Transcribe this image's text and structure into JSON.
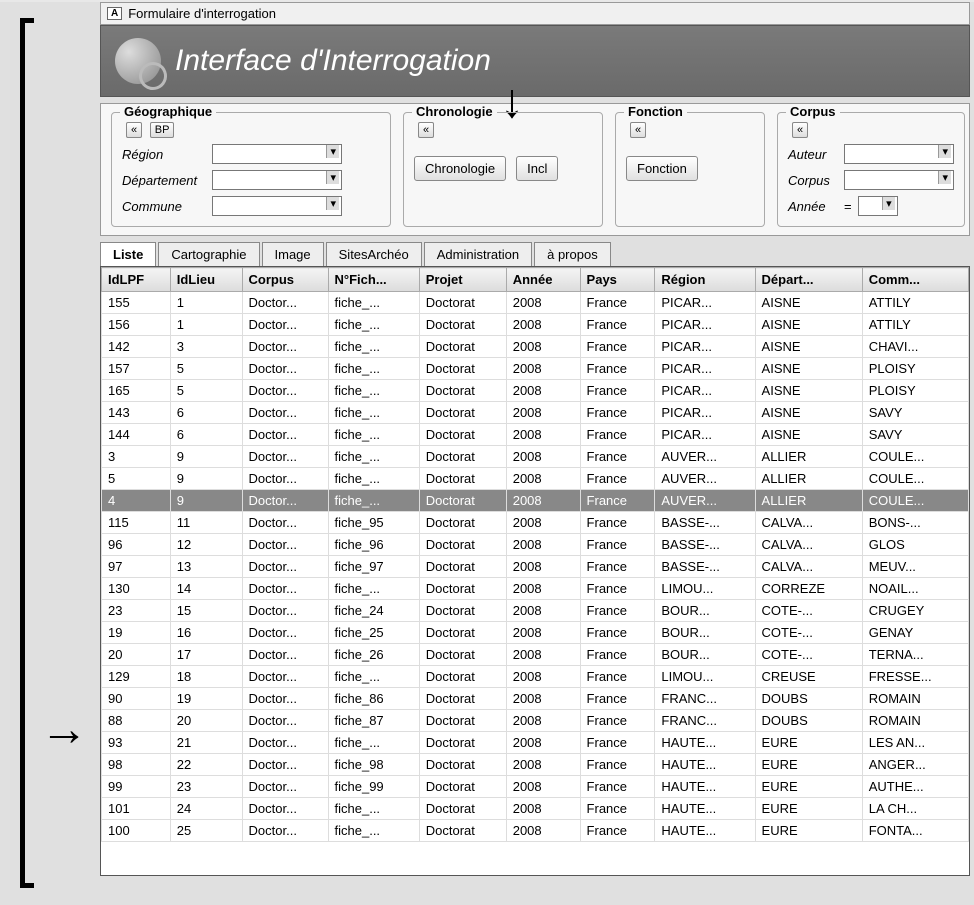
{
  "window_title": "Formulaire d'interrogation",
  "header_title": "Interface d'Interrogation",
  "filters": {
    "geo": {
      "legend": "Géographique",
      "btn_collapse": "«",
      "btn_bp": "BP",
      "region_label": "Région",
      "dept_label": "Département",
      "commune_label": "Commune"
    },
    "chrono": {
      "legend": "Chronologie",
      "btn_collapse": "«",
      "btn_chrono": "Chronologie",
      "btn_incl": "Incl"
    },
    "fonction": {
      "legend": "Fonction",
      "btn_collapse": "«",
      "btn_fonction": "Fonction"
    },
    "corpus": {
      "legend": "Corpus",
      "btn_collapse": "«",
      "auteur_label": "Auteur",
      "corpus_label": "Corpus",
      "annee_label": "Année",
      "annee_op": "="
    }
  },
  "tabs": [
    "Liste",
    "Cartographie",
    "Image",
    "SitesArchéo",
    "Administration",
    "à propos"
  ],
  "columns": [
    "IdLPF",
    "IdLieu",
    "Corpus",
    "N°Fich...",
    "Projet",
    "Année",
    "Pays",
    "Région",
    "Départ...",
    "Comm..."
  ],
  "rows": [
    {
      "idlpf": "155",
      "idlieu": "1",
      "corpus": "Doctor...",
      "fiche": "fiche_...",
      "projet": "Doctorat",
      "annee": "2008",
      "pays": "France",
      "region": "PICAR...",
      "dept": "AISNE",
      "comm": "ATTILY"
    },
    {
      "idlpf": "156",
      "idlieu": "1",
      "corpus": "Doctor...",
      "fiche": "fiche_...",
      "projet": "Doctorat",
      "annee": "2008",
      "pays": "France",
      "region": "PICAR...",
      "dept": "AISNE",
      "comm": "ATTILY"
    },
    {
      "idlpf": "142",
      "idlieu": "3",
      "corpus": "Doctor...",
      "fiche": "fiche_...",
      "projet": "Doctorat",
      "annee": "2008",
      "pays": "France",
      "region": "PICAR...",
      "dept": "AISNE",
      "comm": "CHAVI..."
    },
    {
      "idlpf": "157",
      "idlieu": "5",
      "corpus": "Doctor...",
      "fiche": "fiche_...",
      "projet": "Doctorat",
      "annee": "2008",
      "pays": "France",
      "region": "PICAR...",
      "dept": "AISNE",
      "comm": "PLOISY"
    },
    {
      "idlpf": "165",
      "idlieu": "5",
      "corpus": "Doctor...",
      "fiche": "fiche_...",
      "projet": "Doctorat",
      "annee": "2008",
      "pays": "France",
      "region": "PICAR...",
      "dept": "AISNE",
      "comm": "PLOISY"
    },
    {
      "idlpf": "143",
      "idlieu": "6",
      "corpus": "Doctor...",
      "fiche": "fiche_...",
      "projet": "Doctorat",
      "annee": "2008",
      "pays": "France",
      "region": "PICAR...",
      "dept": "AISNE",
      "comm": "SAVY"
    },
    {
      "idlpf": "144",
      "idlieu": "6",
      "corpus": "Doctor...",
      "fiche": "fiche_...",
      "projet": "Doctorat",
      "annee": "2008",
      "pays": "France",
      "region": "PICAR...",
      "dept": "AISNE",
      "comm": "SAVY"
    },
    {
      "idlpf": "3",
      "idlieu": "9",
      "corpus": "Doctor...",
      "fiche": "fiche_...",
      "projet": "Doctorat",
      "annee": "2008",
      "pays": "France",
      "region": "AUVER...",
      "dept": "ALLIER",
      "comm": "COULE..."
    },
    {
      "idlpf": "5",
      "idlieu": "9",
      "corpus": "Doctor...",
      "fiche": "fiche_...",
      "projet": "Doctorat",
      "annee": "2008",
      "pays": "France",
      "region": "AUVER...",
      "dept": "ALLIER",
      "comm": "COULE..."
    },
    {
      "idlpf": "4",
      "idlieu": "9",
      "corpus": "Doctor...",
      "fiche": "fiche_...",
      "projet": "Doctorat",
      "annee": "2008",
      "pays": "France",
      "region": "AUVER...",
      "dept": "ALLIER",
      "comm": "COULE...",
      "selected": true
    },
    {
      "idlpf": "115",
      "idlieu": "11",
      "corpus": "Doctor...",
      "fiche": "fiche_95",
      "projet": "Doctorat",
      "annee": "2008",
      "pays": "France",
      "region": "BASSE-...",
      "dept": "CALVA...",
      "comm": "BONS-..."
    },
    {
      "idlpf": "96",
      "idlieu": "12",
      "corpus": "Doctor...",
      "fiche": "fiche_96",
      "projet": "Doctorat",
      "annee": "2008",
      "pays": "France",
      "region": "BASSE-...",
      "dept": "CALVA...",
      "comm": "GLOS"
    },
    {
      "idlpf": "97",
      "idlieu": "13",
      "corpus": "Doctor...",
      "fiche": "fiche_97",
      "projet": "Doctorat",
      "annee": "2008",
      "pays": "France",
      "region": "BASSE-...",
      "dept": "CALVA...",
      "comm": "MEUV..."
    },
    {
      "idlpf": "130",
      "idlieu": "14",
      "corpus": "Doctor...",
      "fiche": "fiche_...",
      "projet": "Doctorat",
      "annee": "2008",
      "pays": "France",
      "region": "LIMOU...",
      "dept": "CORREZE",
      "comm": "NOAIL..."
    },
    {
      "idlpf": "23",
      "idlieu": "15",
      "corpus": "Doctor...",
      "fiche": "fiche_24",
      "projet": "Doctorat",
      "annee": "2008",
      "pays": "France",
      "region": "BOUR...",
      "dept": "COTE-...",
      "comm": "CRUGEY"
    },
    {
      "idlpf": "19",
      "idlieu": "16",
      "corpus": "Doctor...",
      "fiche": "fiche_25",
      "projet": "Doctorat",
      "annee": "2008",
      "pays": "France",
      "region": "BOUR...",
      "dept": "COTE-...",
      "comm": "GENAY"
    },
    {
      "idlpf": "20",
      "idlieu": "17",
      "corpus": "Doctor...",
      "fiche": "fiche_26",
      "projet": "Doctorat",
      "annee": "2008",
      "pays": "France",
      "region": "BOUR...",
      "dept": "COTE-...",
      "comm": "TERNA..."
    },
    {
      "idlpf": "129",
      "idlieu": "18",
      "corpus": "Doctor...",
      "fiche": "fiche_...",
      "projet": "Doctorat",
      "annee": "2008",
      "pays": "France",
      "region": "LIMOU...",
      "dept": "CREUSE",
      "comm": "FRESSE..."
    },
    {
      "idlpf": "90",
      "idlieu": "19",
      "corpus": "Doctor...",
      "fiche": "fiche_86",
      "projet": "Doctorat",
      "annee": "2008",
      "pays": "France",
      "region": "FRANC...",
      "dept": "DOUBS",
      "comm": "ROMAIN"
    },
    {
      "idlpf": "88",
      "idlieu": "20",
      "corpus": "Doctor...",
      "fiche": "fiche_87",
      "projet": "Doctorat",
      "annee": "2008",
      "pays": "France",
      "region": "FRANC...",
      "dept": "DOUBS",
      "comm": "ROMAIN"
    },
    {
      "idlpf": "93",
      "idlieu": "21",
      "corpus": "Doctor...",
      "fiche": "fiche_...",
      "projet": "Doctorat",
      "annee": "2008",
      "pays": "France",
      "region": "HAUTE...",
      "dept": "EURE",
      "comm": "LES AN..."
    },
    {
      "idlpf": "98",
      "idlieu": "22",
      "corpus": "Doctor...",
      "fiche": "fiche_98",
      "projet": "Doctorat",
      "annee": "2008",
      "pays": "France",
      "region": "HAUTE...",
      "dept": "EURE",
      "comm": "ANGER..."
    },
    {
      "idlpf": "99",
      "idlieu": "23",
      "corpus": "Doctor...",
      "fiche": "fiche_99",
      "projet": "Doctorat",
      "annee": "2008",
      "pays": "France",
      "region": "HAUTE...",
      "dept": "EURE",
      "comm": "AUTHE..."
    },
    {
      "idlpf": "101",
      "idlieu": "24",
      "corpus": "Doctor...",
      "fiche": "fiche_...",
      "projet": "Doctorat",
      "annee": "2008",
      "pays": "France",
      "region": "HAUTE...",
      "dept": "EURE",
      "comm": "LA CH..."
    },
    {
      "idlpf": "100",
      "idlieu": "25",
      "corpus": "Doctor...",
      "fiche": "fiche_...",
      "projet": "Doctorat",
      "annee": "2008",
      "pays": "France",
      "region": "HAUTE...",
      "dept": "EURE",
      "comm": "FONTA..."
    }
  ]
}
